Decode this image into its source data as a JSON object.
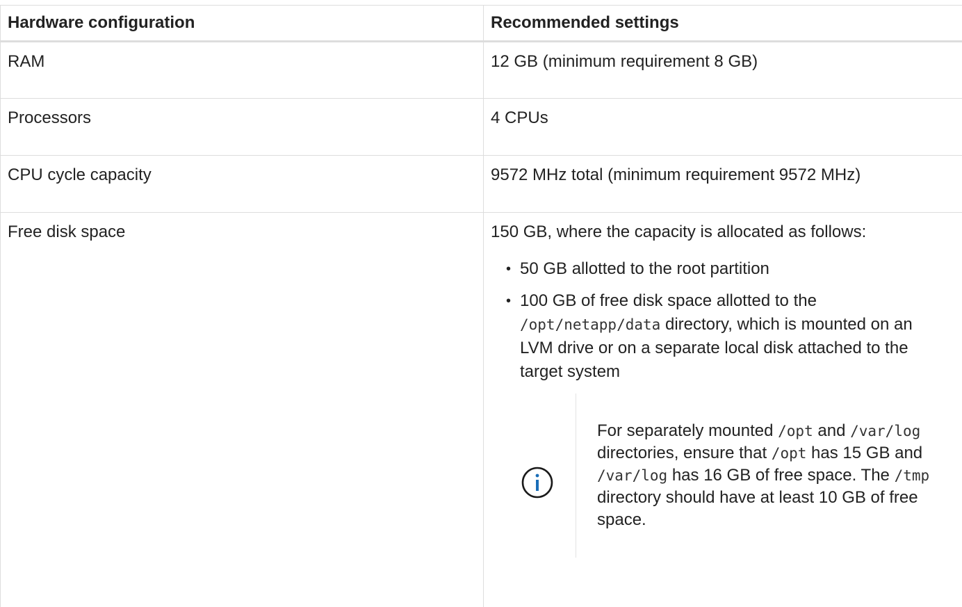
{
  "table": {
    "headers": [
      "Hardware configuration",
      "Recommended settings"
    ],
    "rows": [
      {
        "config": "RAM",
        "setting": "12 GB (minimum requirement 8 GB)"
      },
      {
        "config": "Processors",
        "setting": "4 CPUs"
      },
      {
        "config": "CPU cycle capacity",
        "setting": "9572 MHz total (minimum requirement 9572 MHz)"
      },
      {
        "config": "Free disk space",
        "setting_intro": "150 GB, where the capacity is allocated as follows:",
        "bullet1": "50 GB allotted to the root partition",
        "bullet2": {
          "pre": "100 GB of free disk space allotted to the ",
          "code": "/opt/netapp/data",
          "post": " directory, which is mounted on an LVM drive or on a separate local disk attached to the target system"
        },
        "note": {
          "icon": "info-circle-icon",
          "t1": "For separately mounted ",
          "c1": "/opt",
          "t2": " and ",
          "c2": "/var/log",
          "t3": " directories, ensure that ",
          "c3": "/opt",
          "t4": " has 15 GB and ",
          "c4": "/var/log",
          "t5": " has 16 GB of free space. The ",
          "c5": "/tmp",
          "t6": " directory should have at least 10 GB of free space."
        }
      }
    ]
  },
  "colors": {
    "border": "#dddddd",
    "text": "#222222",
    "info_icon": "#1a6eb8"
  }
}
